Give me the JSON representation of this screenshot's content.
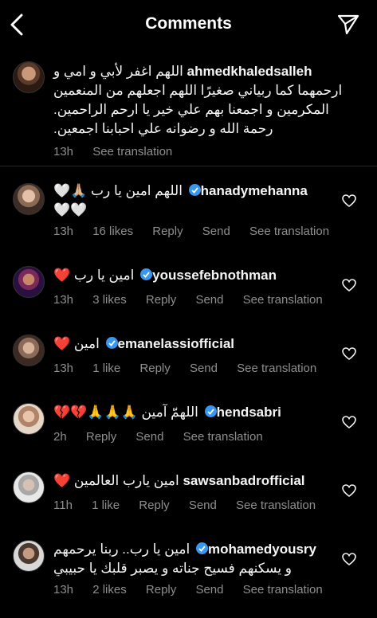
{
  "header": {
    "title": "Comments",
    "back_icon": "chevron-left-icon",
    "share_icon": "paper-plane-icon"
  },
  "caption": {
    "username": "ahmedkhaledsalleh",
    "text_line1": "اللهم اغفر لأبي و امي و",
    "text_rest": "ارحمهما كما ربياني صغيرًا اللهم اجعلهم من المنعمين المكرمين و اجمعنا بهم علي خير يا ارحم الراحمين. رحمة الله و رضوانه علي احبابنا اجمعين.",
    "time": "13h",
    "translate": "See translation"
  },
  "comments": [
    {
      "username": "hanadymehanna",
      "verified": true,
      "text_line1": "اللهم امين يا رب 🙏🏼🤍",
      "text_rest": "🤍🤍",
      "time": "13h",
      "likes": "16 likes",
      "reply": "Reply",
      "send": "Send",
      "translate": "See translation"
    },
    {
      "username": "youssefebnothman",
      "verified": true,
      "text_line1": "امين يا رب ❤️",
      "time": "13h",
      "likes": "3 likes",
      "reply": "Reply",
      "send": "Send",
      "translate": "See translation"
    },
    {
      "username": "emanelassiofficial",
      "verified": true,
      "text_line1": "امين ❤️",
      "time": "13h",
      "likes": "1 like",
      "reply": "Reply",
      "send": "Send",
      "translate": "See translation"
    },
    {
      "username": "hendsabri",
      "verified": true,
      "text_line1": "اللهمّ آمين 🙏🙏🙏💔💔",
      "time": "2h",
      "reply": "Reply",
      "send": "Send",
      "translate": "See translation"
    },
    {
      "username": "sawsanbadrofficial",
      "verified": false,
      "text_line1": "امين يارب العالمين ❤️",
      "time": "11h",
      "likes": "1 like",
      "reply": "Reply",
      "send": "Send",
      "translate": "See translation"
    },
    {
      "username": "mohamedyousry",
      "verified": true,
      "text_line1": "امين يا رب.. ربنا يرحمهم",
      "text_rest": "و يسكنهم فسيح جناته و يصبر قلبك يا حبيبي",
      "time": "13h",
      "likes": "2 likes",
      "reply": "Reply",
      "send": "Send",
      "translate": "See translation"
    }
  ],
  "colors": {
    "background": "#000000",
    "text": "#f5f5f5",
    "meta": "#8e8e8e",
    "verified": "#3897f0",
    "separator": "#262626"
  }
}
